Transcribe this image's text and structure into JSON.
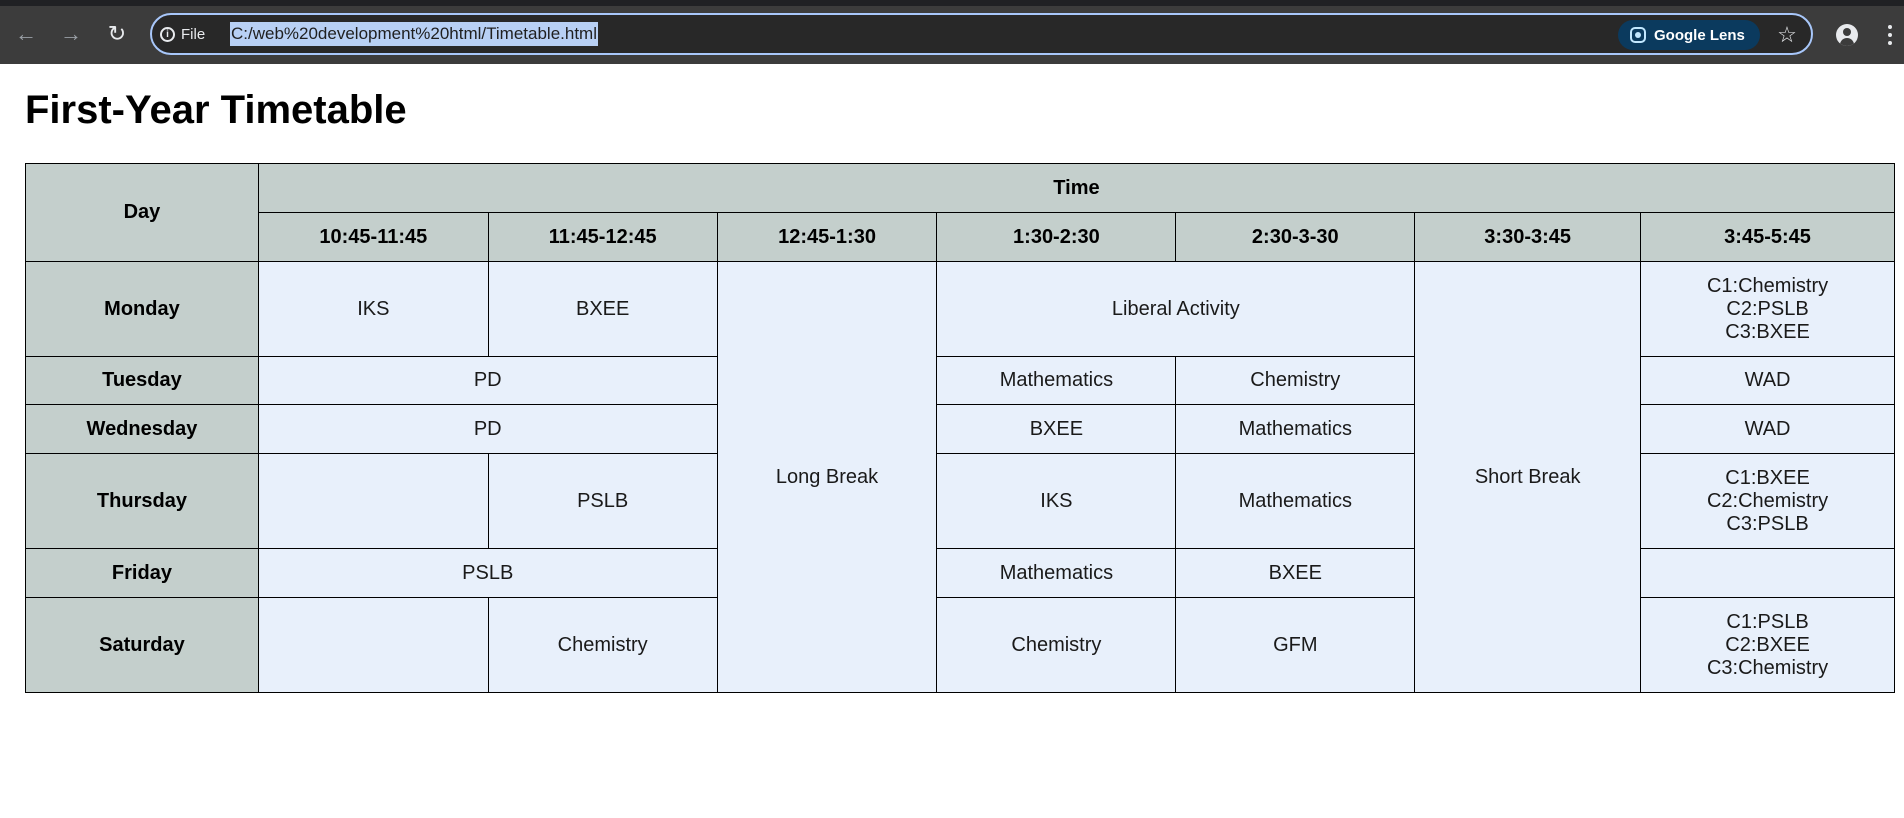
{
  "browser": {
    "site_info_label": "File",
    "url": "C:/web%20development%20html/Timetable.html",
    "lens_label": "Google Lens",
    "icons": {
      "back": "arrow-left-icon",
      "forward": "arrow-right-icon",
      "reload": "reload-icon",
      "info": "info-icon",
      "lens": "google-lens-icon",
      "bookmark": "star-icon",
      "profile": "profile-icon",
      "menu": "kebab-menu-icon"
    }
  },
  "page": {
    "title": "First-Year Timetable"
  },
  "timetable": {
    "headers": {
      "day": "Day",
      "time": "Time",
      "slots": [
        "10:45-11:45",
        "11:45-12:45",
        "12:45-1:30",
        "1:30-2:30",
        "2:30-3-30",
        "3:30-3:45",
        "3:45-5:45"
      ]
    },
    "breaks": {
      "long": "Long Break",
      "short": "Short Break"
    },
    "rows": {
      "monday": {
        "day": "Monday",
        "s1": "IKS",
        "s2": "BXEE",
        "afternoon": "Liberal Activity",
        "last": [
          "C1:Chemistry",
          "C2:PSLB",
          "C3:BXEE"
        ]
      },
      "tuesday": {
        "day": "Tuesday",
        "morning": "PD",
        "s4": "Mathematics",
        "s5": "Chemistry",
        "last": "WAD"
      },
      "wednesday": {
        "day": "Wednesday",
        "morning": "PD",
        "s4": "BXEE",
        "s5": "Mathematics",
        "last": "WAD"
      },
      "thursday": {
        "day": "Thursday",
        "s1": "",
        "s2": "PSLB",
        "s4": "IKS",
        "s5": "Mathematics",
        "last": [
          "C1:BXEE",
          "C2:Chemistry",
          "C3:PSLB"
        ]
      },
      "friday": {
        "day": "Friday",
        "morning": "PSLB",
        "s4": "Mathematics",
        "s5": "BXEE",
        "last": ""
      },
      "saturday": {
        "day": "Saturday",
        "s1": "",
        "s2": "Chemistry",
        "s4": "Chemistry",
        "s5": "GFM",
        "last": [
          "C1:PSLB",
          "C2:BXEE",
          "C3:Chemistry"
        ]
      }
    }
  },
  "colors": {
    "header_bg": "#c4cfcc",
    "cell_bg": "#e8f0fb",
    "toolbar_bg": "#3c3c3c",
    "url_highlight": "#b8d0f4"
  }
}
